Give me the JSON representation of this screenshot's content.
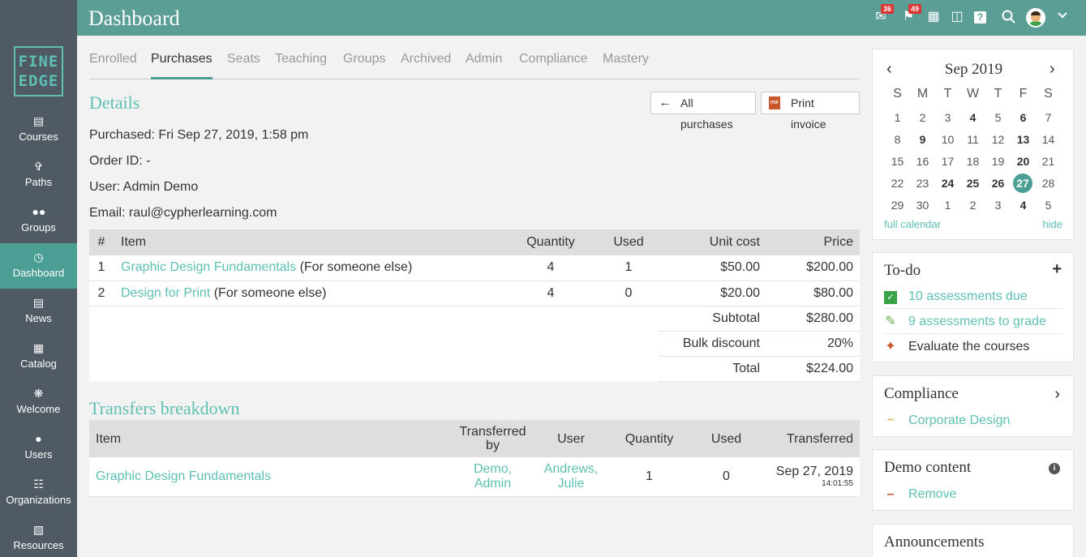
{
  "header": {
    "title": "Dashboard",
    "messages_count": "36",
    "notifications_count": "49"
  },
  "logo": {
    "line1": "FINE",
    "line2": "EDGE"
  },
  "sidebar": {
    "items": [
      {
        "label": "Courses",
        "icon": "book-icon"
      },
      {
        "label": "Paths",
        "icon": "signpost-icon"
      },
      {
        "label": "Groups",
        "icon": "groups-icon"
      },
      {
        "label": "Dashboard",
        "icon": "dashboard-icon"
      },
      {
        "label": "News",
        "icon": "news-icon"
      },
      {
        "label": "Catalog",
        "icon": "catalog-icon"
      },
      {
        "label": "Welcome",
        "icon": "welcome-icon"
      },
      {
        "label": "Users",
        "icon": "user-icon"
      },
      {
        "label": "Organizations",
        "icon": "organizations-icon"
      },
      {
        "label": "Resources",
        "icon": "resources-icon"
      }
    ]
  },
  "tabs": [
    "Enrolled",
    "Purchases",
    "Seats",
    "Teaching",
    "Groups",
    "Archived",
    "Admin",
    "Compliance",
    "Mastery"
  ],
  "details": {
    "title": "Details",
    "all_purchases_label": "All purchases",
    "print_invoice_label": "Print invoice",
    "pdf_text": "PDF",
    "purchased": "Purchased: Fri Sep 27, 2019, 1:58 pm",
    "order_id": "Order ID: -",
    "user": "User: Admin Demo",
    "email": "Email: raul@cypherlearning.com"
  },
  "purchases_table": {
    "headers": {
      "num": "#",
      "item": "Item",
      "quantity": "Quantity",
      "used": "Used",
      "unit_cost": "Unit cost",
      "price": "Price"
    },
    "rows": [
      {
        "num": "1",
        "item": "Graphic Design Fundamentals",
        "note": "(For someone else)",
        "quantity": "4",
        "used": "1",
        "unit_cost": "$50.00",
        "price": "$200.00"
      },
      {
        "num": "2",
        "item": "Design for Print",
        "note": "(For someone else)",
        "quantity": "4",
        "used": "0",
        "unit_cost": "$20.00",
        "price": "$80.00"
      }
    ],
    "subtotal_label": "Subtotal",
    "subtotal": "$280.00",
    "discount_label": "Bulk discount",
    "discount": "20%",
    "total_label": "Total",
    "total": "$224.00"
  },
  "transfers": {
    "title": "Transfers breakdown",
    "headers": {
      "item": "Item",
      "transferred_by_1": "Transferred",
      "transferred_by_2": "by",
      "user": "User",
      "quantity": "Quantity",
      "used": "Used",
      "transferred": "Transferred"
    },
    "row": {
      "item": "Graphic Design Fundamentals",
      "by_1": "Demo,",
      "by_2": "Admin",
      "user_1": "Andrews,",
      "user_2": "Julie",
      "quantity": "1",
      "used": "0",
      "date": "Sep 27, 2019",
      "time": "14:01:55"
    }
  },
  "calendar": {
    "month": "Sep 2019",
    "weekdays": [
      "S",
      "M",
      "T",
      "W",
      "T",
      "F",
      "S"
    ],
    "weeks": [
      [
        "1",
        "2",
        "3",
        "4",
        "5",
        "6",
        "7"
      ],
      [
        "8",
        "9",
        "10",
        "11",
        "12",
        "13",
        "14"
      ],
      [
        "15",
        "16",
        "17",
        "18",
        "19",
        "20",
        "21"
      ],
      [
        "22",
        "23",
        "24",
        "25",
        "26",
        "27",
        "28"
      ],
      [
        "29",
        "30",
        "1",
        "2",
        "3",
        "4",
        "5"
      ]
    ],
    "bold_days": [
      "6",
      "9",
      "13",
      "20",
      "24",
      "25",
      "26",
      "4"
    ],
    "today": "27",
    "full_calendar_label": "full calendar",
    "hide_label": "hide"
  },
  "todo": {
    "title": "To-do",
    "items": [
      {
        "label": "10 assessments due"
      },
      {
        "label": "9 assessments to grade"
      },
      {
        "label": "Evaluate the courses"
      }
    ]
  },
  "compliance": {
    "title": "Compliance",
    "item": "Corporate Design"
  },
  "demo_content": {
    "title": "Demo content",
    "item": "Remove"
  },
  "announcements": {
    "title": "Announcements"
  },
  "colors": {
    "accent": "#5a9e95",
    "link": "#5ebfb3",
    "sidebar": "#4f5a65"
  }
}
